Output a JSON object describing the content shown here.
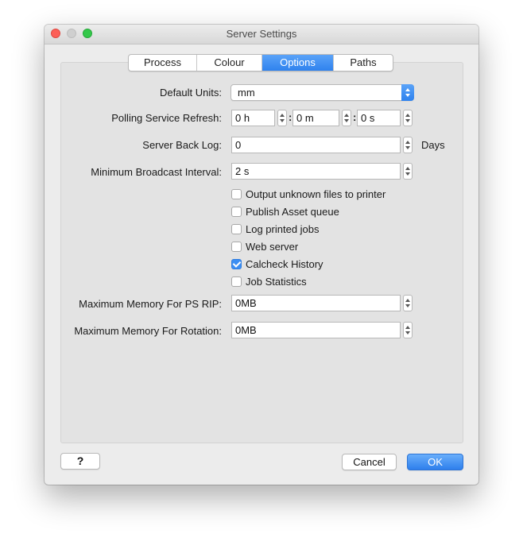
{
  "window": {
    "title": "Server Settings"
  },
  "tabs": [
    {
      "label": "Process"
    },
    {
      "label": "Colour"
    },
    {
      "label": "Options",
      "active": true
    },
    {
      "label": "Paths"
    }
  ],
  "fields": {
    "default_units": {
      "label": "Default Units:",
      "value": "mm"
    },
    "polling_refresh": {
      "label": "Polling Service Refresh:",
      "hours": "0 h",
      "minutes": "0 m",
      "seconds": "0 s",
      "separator": ":"
    },
    "server_back_log": {
      "label": "Server Back Log:",
      "value": "0",
      "unit": "Days"
    },
    "min_broadcast": {
      "label": "Minimum Broadcast Interval:",
      "value": "2 s"
    },
    "max_mem_ps_rip": {
      "label": "Maximum Memory For PS RIP:",
      "value": "0MB"
    },
    "max_mem_rotation": {
      "label": "Maximum Memory For Rotation:",
      "value": "0MB"
    }
  },
  "checkboxes": [
    {
      "label": "Output unknown files to printer",
      "checked": false
    },
    {
      "label": "Publish Asset queue",
      "checked": false
    },
    {
      "label": "Log printed jobs",
      "checked": false
    },
    {
      "label": "Web server",
      "checked": false
    },
    {
      "label": "Calcheck History",
      "checked": true
    },
    {
      "label": "Job Statistics",
      "checked": false
    }
  ],
  "buttons": {
    "help": "?",
    "cancel": "Cancel",
    "ok": "OK"
  },
  "colors": {
    "accent": "#3b8ef3",
    "close": "#fc5f57",
    "zoom": "#34c84a"
  }
}
